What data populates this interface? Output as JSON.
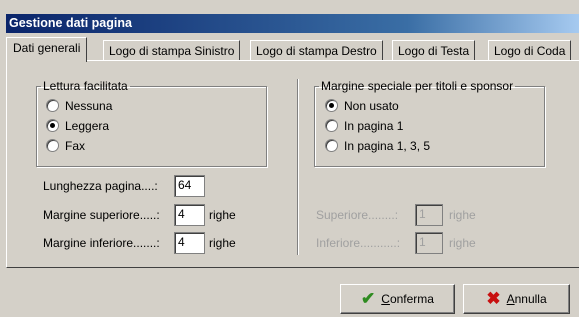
{
  "window": {
    "title": "Gestione dati pagina"
  },
  "tabs": [
    {
      "label": "Dati generali",
      "active": true
    },
    {
      "label": "Logo di stampa Sinistro",
      "active": false
    },
    {
      "label": "Logo di stampa Destro",
      "active": false
    },
    {
      "label": "Logo di Testa",
      "active": false
    },
    {
      "label": "Logo di Coda",
      "active": false
    }
  ],
  "lettura": {
    "legend": "Lettura facilitata",
    "options": [
      "Nessuna",
      "Leggera",
      "Fax"
    ],
    "selected": "Leggera"
  },
  "margine_speciale": {
    "legend": "Margine speciale per titoli e sponsor",
    "options": [
      "Non usato",
      "In pagina 1",
      "In pagina 1, 3, 5"
    ],
    "selected": "Non usato"
  },
  "fields": {
    "lunghezza": {
      "label": "Lunghezza pagina....:",
      "value": "64"
    },
    "margine_superiore": {
      "label": "Margine superiore.....:",
      "value": "4",
      "unit": "righe"
    },
    "margine_inferiore": {
      "label": "Margine inferiore.......:",
      "value": "4",
      "unit": "righe"
    },
    "superiore": {
      "label": "Superiore........:",
      "value": "1",
      "unit": "righe"
    },
    "inferiore": {
      "label": "Inferiore...........:",
      "value": "1",
      "unit": "righe"
    }
  },
  "buttons": {
    "confirm": {
      "pre": "",
      "accel": "C",
      "post": "onferma",
      "icon": "check-icon",
      "color": "#2e8b20"
    },
    "cancel": {
      "pre": "",
      "accel": "A",
      "post": "nnulla",
      "icon": "cross-icon",
      "color": "#c81010"
    }
  }
}
